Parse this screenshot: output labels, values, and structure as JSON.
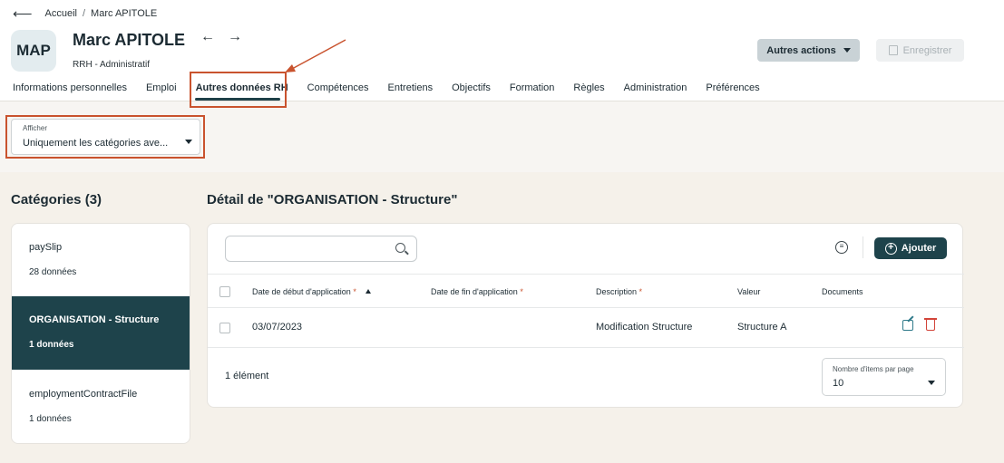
{
  "breadcrumb": {
    "home": "Accueil",
    "separator": "/",
    "current": "Marc APITOLE"
  },
  "profile": {
    "initials": "MAP",
    "name": "Marc APITOLE",
    "role": "RRH - Administratif"
  },
  "header_actions": {
    "more_actions": "Autres actions",
    "save": "Enregistrer"
  },
  "tabs": [
    "Informations personnelles",
    "Emploi",
    "Autres données RH",
    "Compétences",
    "Entretiens",
    "Objectifs",
    "Formation",
    "Règles",
    "Administration",
    "Préférences"
  ],
  "active_tab": "Autres données RH",
  "filter": {
    "label": "Afficher",
    "value": "Uniquement les catégories ave..."
  },
  "categories": {
    "title": "Catégories (3)",
    "items": [
      {
        "name": "paySlip",
        "count": "28 données"
      },
      {
        "name": "ORGANISATION - Structure",
        "count": "1 données"
      },
      {
        "name": "employmentContractFile",
        "count": "1 données"
      }
    ],
    "selected_index": 1
  },
  "detail": {
    "title": "Détail de \"ORGANISATION - Structure\"",
    "search_placeholder": "",
    "add_label": "Ajouter",
    "columns": {
      "start_date": "Date de début d'application",
      "end_date": "Date de fin d'application",
      "description": "Description",
      "value": "Valeur",
      "documents": "Documents",
      "required_mark": "*"
    },
    "rows": [
      {
        "start_date": "03/07/2023",
        "end_date": "",
        "description": "Modification Structure",
        "value": "Structure A",
        "documents": ""
      }
    ],
    "count_text": "1 élément",
    "per_page_label": "Nombre d'items par page",
    "per_page_value": "10"
  },
  "colors": {
    "primary": "#1e434b",
    "annotation": "#c9532e",
    "delete": "#d2453a",
    "edit": "#2f7a8a"
  },
  "icons": [
    "back-arrow-icon",
    "prev-arrow-icon",
    "next-arrow-icon",
    "save-icon",
    "search-icon",
    "filter-icon",
    "plus-icon",
    "sort-up-icon",
    "edit-icon",
    "trash-icon"
  ]
}
